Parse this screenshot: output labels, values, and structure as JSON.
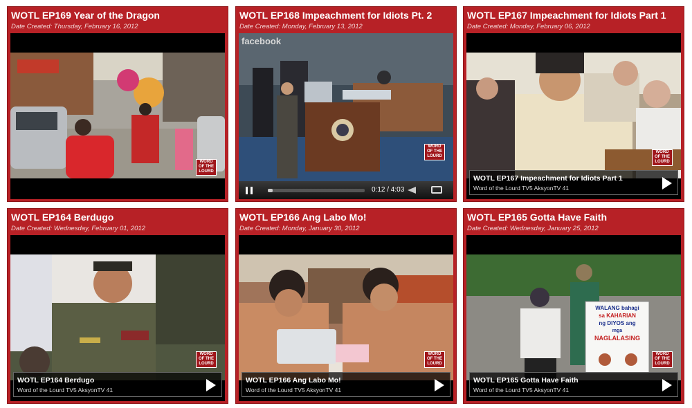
{
  "videos": [
    {
      "title": "WOTL EP169 Year of the Dragon",
      "date": "Date Created: Thursday, February 16, 2012"
    },
    {
      "title": "WOTL EP168 Impeachment for Idiots Pt. 2",
      "date": "Date Created: Monday, February 13, 2012",
      "player": {
        "watermark": "facebook",
        "time": "0:12 / 4:03",
        "progress": 0.05
      }
    },
    {
      "title": "WOTL EP167 Impeachment for Idiots Part 1",
      "date": "Date Created: Monday, February 06, 2012",
      "overlay_title": "WOTL EP167 Impeachment for Idiots Part 1",
      "overlay_sub": "Word of the Lourd TV5 AksyonTV 41"
    },
    {
      "title": "WOTL EP164 Berdugo",
      "date": "Date Created: Wednesday, February 01, 2012",
      "overlay_title": "WOTL EP164 Berdugo",
      "overlay_sub": "Word of the Lourd TV5 AksyonTV 41"
    },
    {
      "title": "WOTL EP166 Ang Labo Mo!",
      "date": "Date Created: Monday, January 30, 2012",
      "overlay_title": "WOTL EP166 Ang Labo Mo!",
      "overlay_sub": "Word of the Lourd TV5 AksyonTV 41"
    },
    {
      "title": "WOTL EP165 Gotta Have Faith",
      "date": "Date Created: Wednesday, January 25, 2012",
      "overlay_title": "WOTL EP165 Gotta Have Faith",
      "overlay_sub": "Word of the Lourd TV5 AksyonTV 41",
      "sign": [
        "WALANG bahagi",
        "sa KAHARIAN",
        "ng DIYOS ang",
        "mga",
        "NAGLALASING"
      ]
    }
  ],
  "logo_text": "WORD OF THE LOURD",
  "colors": {
    "card": "#b72126",
    "player": "#000000"
  }
}
